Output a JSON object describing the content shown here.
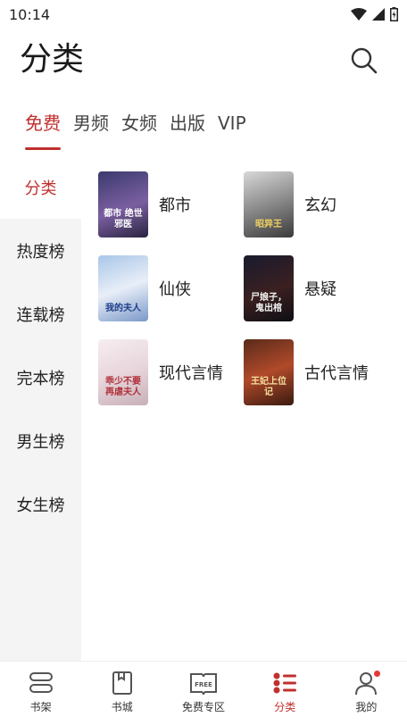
{
  "status_bar": {
    "time": "10:14"
  },
  "header": {
    "title": "分类"
  },
  "tabs": [
    {
      "label": "免费",
      "active": true
    },
    {
      "label": "男频"
    },
    {
      "label": "女频"
    },
    {
      "label": "出版"
    },
    {
      "label": "VIP"
    }
  ],
  "sidebar": [
    {
      "label": "分类",
      "active": true
    },
    {
      "label": "热度榜"
    },
    {
      "label": "连载榜"
    },
    {
      "label": "完本榜"
    },
    {
      "label": "男生榜"
    },
    {
      "label": "女生榜"
    }
  ],
  "categories": [
    {
      "label": "都市",
      "cover_text": "都市 绝世邪医"
    },
    {
      "label": "玄幻",
      "cover_text": "昭异王"
    },
    {
      "label": "仙侠",
      "cover_text": "我的夫人"
    },
    {
      "label": "悬疑",
      "cover_text": "尸娘子，鬼出棺"
    },
    {
      "label": "现代言情",
      "cover_text": "乖少不要再虐夫人"
    },
    {
      "label": "古代言情",
      "cover_text": "王妃上位记"
    }
  ],
  "bottom_nav": [
    {
      "label": "书架",
      "icon": "bookshelf-icon"
    },
    {
      "label": "书城",
      "icon": "bookstore-icon"
    },
    {
      "label": "免费专区",
      "icon": "free-zone-icon",
      "icon_text": "FREE"
    },
    {
      "label": "分类",
      "icon": "category-icon",
      "active": true
    },
    {
      "label": "我的",
      "icon": "profile-icon",
      "badge": true
    }
  ],
  "colors": {
    "accent": "#c0302f",
    "sidebar_bg": "#f4f4f4"
  }
}
